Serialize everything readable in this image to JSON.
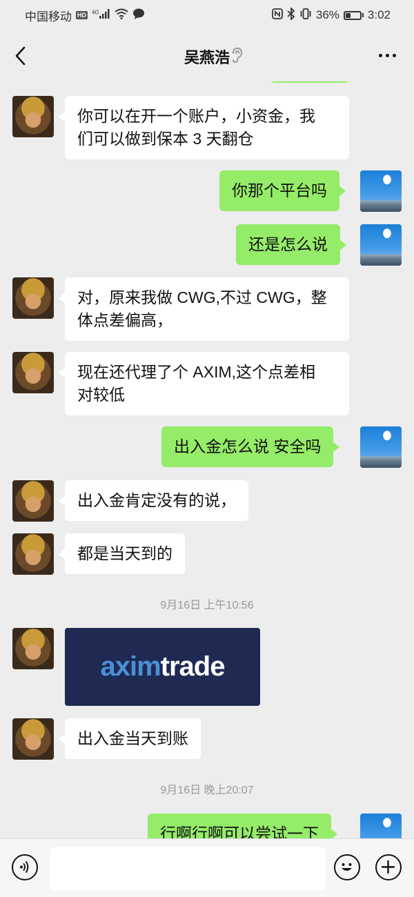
{
  "status_bar": {
    "carrier": "中国移动",
    "hd": "HD",
    "network": "4G",
    "battery_pct_text": "36%",
    "battery_level": 0.36,
    "time": "3:02"
  },
  "header": {
    "title": "吴燕浩",
    "back_icon": "chevron-left-icon",
    "ear_icon": "ear-icon",
    "more_icon": "more-dots-icon"
  },
  "messages": [
    {
      "side": "left",
      "text_lines": [
        "你可以在开一个账户，小资金，我",
        "们可以做到保本 3 天翻仓"
      ]
    },
    {
      "side": "right",
      "text_lines": [
        "你那个平台吗"
      ]
    },
    {
      "side": "right",
      "text_lines": [
        "还是怎么说"
      ]
    },
    {
      "side": "left",
      "text_lines": [
        "对，原来我做 CWG,不过 CWG，整",
        "体点差偏高，"
      ]
    },
    {
      "side": "left",
      "text_lines": [
        "现在还代理了个 AXIM,这个点差相",
        "对较低"
      ]
    },
    {
      "side": "right",
      "text_lines": [
        "出入金怎么说 安全吗"
      ]
    },
    {
      "side": "left",
      "text_lines": [
        "出入金肯定没有的说，"
      ]
    },
    {
      "side": "left",
      "text_lines": [
        "都是当天到的"
      ]
    },
    {
      "timestamp": "9月16日 上午10:56"
    },
    {
      "side": "left",
      "image_logo": {
        "part1": "axim",
        "part2": "trade"
      }
    },
    {
      "side": "left",
      "text_lines": [
        "出入金当天到账"
      ]
    },
    {
      "timestamp": "9月16日 晚上20:07"
    },
    {
      "side": "right",
      "text_lines": [
        "行啊行啊可以尝试一下"
      ]
    }
  ],
  "input_bar": {
    "voice_icon": "voice-icon",
    "emoji_icon": "emoji-icon",
    "plus_icon": "plus-icon",
    "placeholder": ""
  },
  "colors": {
    "background": "#ededed",
    "bubble_left": "#ffffff",
    "bubble_right": "#95ec69",
    "timestamp_text": "#999999"
  }
}
